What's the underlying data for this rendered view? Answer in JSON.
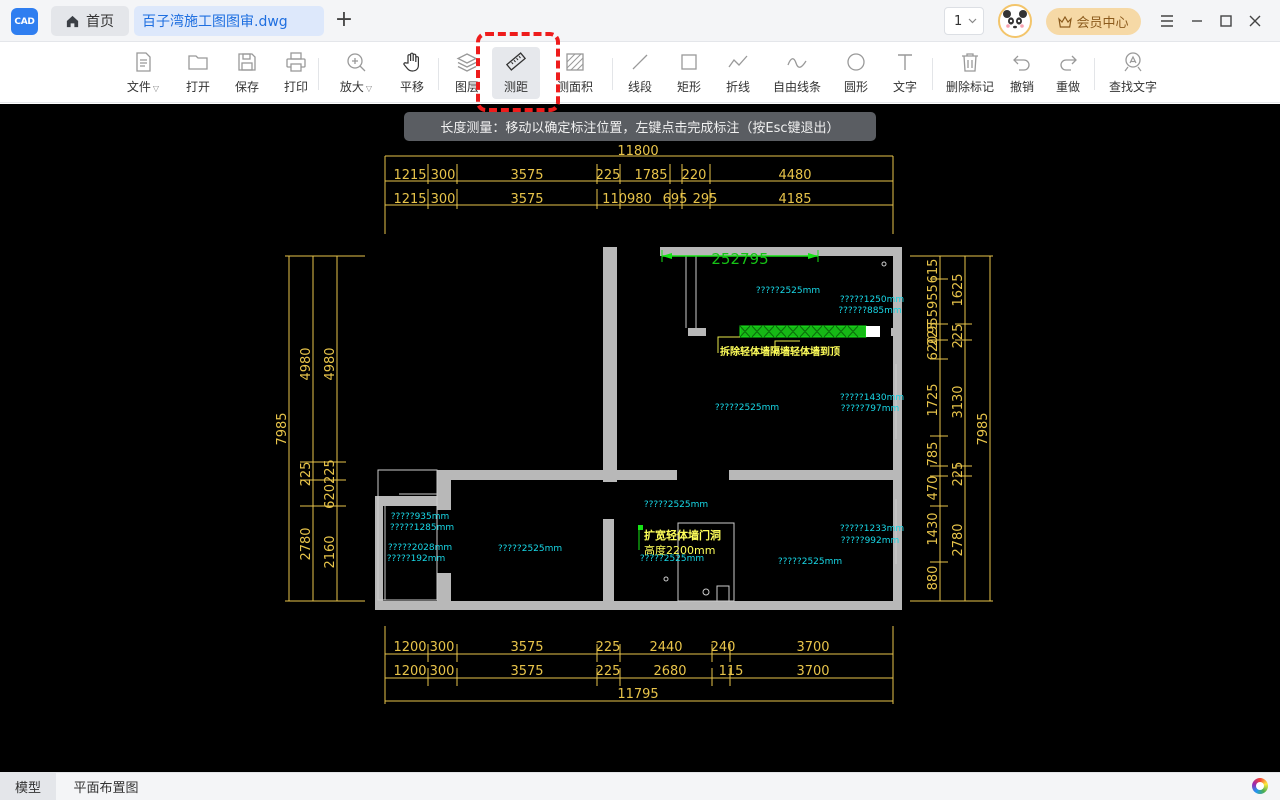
{
  "app": {
    "logo_text": "CAD"
  },
  "tabs": {
    "home_label": "首页",
    "file_label": "百子湾施工图图审.dwg",
    "add_symbol": "+"
  },
  "header": {
    "page_value": "1",
    "vip_label": "会员中心"
  },
  "toolbar": {
    "file": "文件",
    "open": "打开",
    "save": "保存",
    "print": "打印",
    "zoom": "放大",
    "pan": "平移",
    "layer": "图层",
    "measure_distance": "测距",
    "measure_area": "测面积",
    "line": "线段",
    "rect": "矩形",
    "polyline": "折线",
    "freeline": "自由线条",
    "circle": "圆形",
    "text": "文字",
    "delete_mark": "删除标记",
    "undo": "撤销",
    "redo": "重做",
    "find_text": "查找文字"
  },
  "hint": "长度测量：移动以确定标注位置，左键点击完成标注（按Esc键退出）",
  "drawing": {
    "top_total": "11800",
    "top_row1": [
      "1215",
      "300",
      "3575",
      "225",
      "1785",
      "220",
      "4480"
    ],
    "top_row2": [
      "1215",
      "300",
      "3575",
      "110980",
      "695",
      "295",
      "4185"
    ],
    "bottom_total": "11795",
    "bottom_row1": [
      "1200",
      "300",
      "3575",
      "225",
      "2440",
      "240",
      "3700"
    ],
    "bottom_row2": [
      "1200",
      "300",
      "3575",
      "225",
      "2680",
      "115",
      "3700"
    ],
    "left_outer": "7985",
    "left_mid": [
      "4980",
      "225",
      "2780"
    ],
    "left_inner": [
      "4980",
      "620225",
      "2160"
    ],
    "right_inner": [
      "615",
      "955955",
      "225",
      "620",
      "1725",
      "785",
      "470",
      "1430",
      "880"
    ],
    "right_mid": [
      "1625",
      "225",
      "3130",
      "225",
      "2780"
    ],
    "right_outer": "7985",
    "measure_value": "252795",
    "room_notes": [
      "?????2525mm",
      "?????1250mm",
      "??????885mm",
      "?????2525mm",
      "?????1430mm",
      "?????797mm",
      "?????2525mm",
      "?????935mm",
      "?????1285mm",
      "?????2028mm",
      "?????192mm",
      "?????2525mm",
      "?????1233mm",
      "?????992mm",
      "?????2525mm",
      "?????2525mm"
    ],
    "demolish_note": "拆除轻体墙隔墙轻体墙到顶",
    "expand_note_1": "扩宽轻体墙门洞",
    "expand_note_2": "高度2200mm"
  },
  "bottom_tabs": {
    "model": "模型",
    "layout": "平面布置图"
  },
  "colors": {
    "accent": "#2f7ef0",
    "highlight": "#ee1c1c",
    "dim": "#e8c44a",
    "cyan": "#18d7e6",
    "green": "#16e316"
  }
}
